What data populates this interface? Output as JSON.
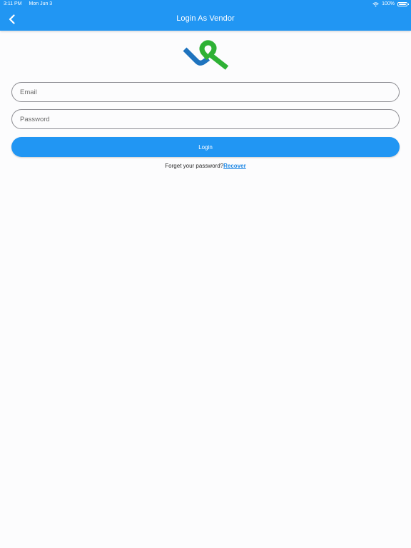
{
  "status_bar": {
    "time": "3:11 PM",
    "date": "Mon Jun 3",
    "battery": "100%",
    "wifi_icon": "wifi-icon",
    "battery_icon": "battery-icon"
  },
  "header": {
    "title": "Login As Vendor",
    "back_icon": "chevron-left-icon",
    "background": "#2196f3"
  },
  "logo": {
    "icon": "vendor-logo",
    "colors": [
      "#1e73be",
      "#2eb135"
    ]
  },
  "form": {
    "email_placeholder": "Email",
    "email_value": "",
    "password_placeholder": "Password",
    "password_value": "",
    "login_label": "Login",
    "forgot_text": "Forget your password?",
    "recover_label": "Recover"
  },
  "colors": {
    "accent": "#2196f3",
    "link": "#1e88e5"
  }
}
